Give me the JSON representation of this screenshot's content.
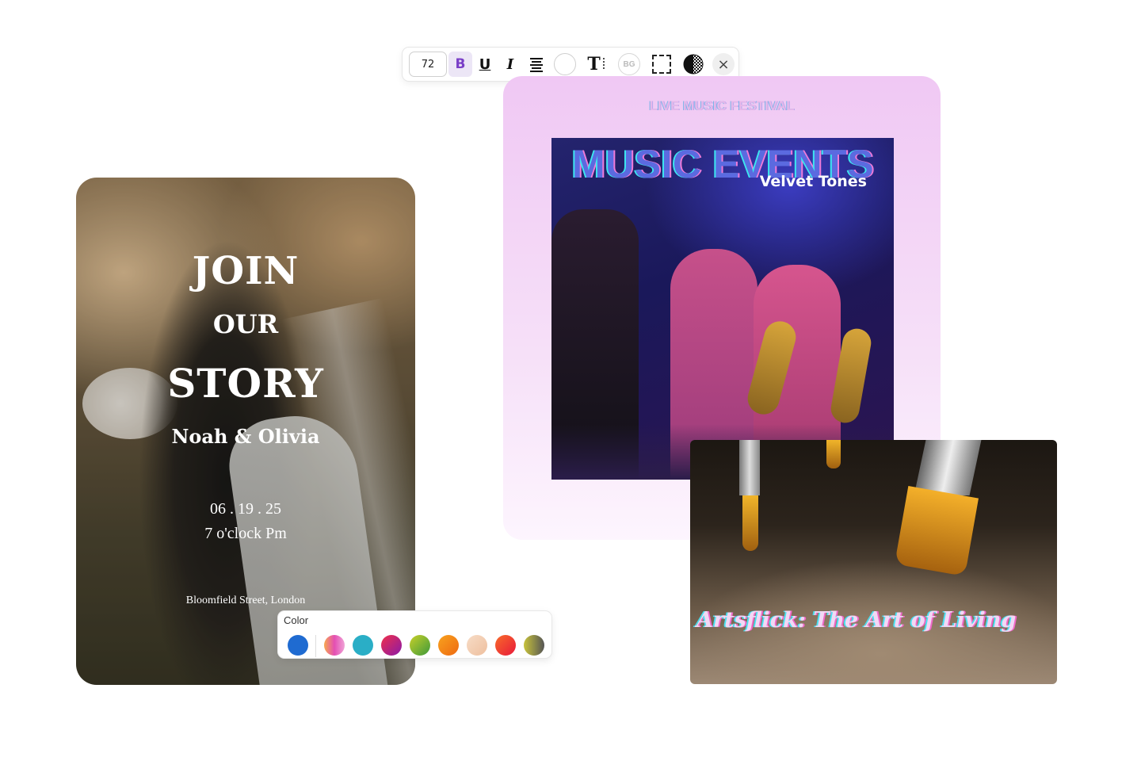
{
  "toolbar": {
    "font_size": "72",
    "bold_label": "B",
    "underline_label": "U",
    "italic_label": "I",
    "text_size_label": "T",
    "bg_label": "BG",
    "close_label": "×",
    "accent_color": "#7a3fc7"
  },
  "wedding_card": {
    "line1": "JOIN",
    "line2": "OUR",
    "line3": "STORY",
    "names": "Noah & Olivia",
    "date": "06 . 19 . 25",
    "time": "7 o'clock Pm",
    "address": "Bloomfield Street, London"
  },
  "color_picker": {
    "label": "Color",
    "swatches": [
      {
        "name": "blue",
        "color": "#1f6bd1"
      },
      {
        "name": "pink-gradient",
        "color": "#e97fb8"
      },
      {
        "name": "teal",
        "color": "#2aaec6"
      },
      {
        "name": "magenta-red",
        "color": "#d12a5a"
      },
      {
        "name": "green-yellow",
        "color": "#8cbf2a"
      },
      {
        "name": "orange",
        "color": "#f28a1e"
      },
      {
        "name": "peach",
        "color": "#f2cbb0"
      },
      {
        "name": "red-orange",
        "color": "#ef3a2e"
      },
      {
        "name": "olive-gradient",
        "color": "#8f9a3a"
      }
    ]
  },
  "music_card": {
    "kicker": "LIVE MUSIC FESTIVAL",
    "headline": "MUSIC EVENTS",
    "subtitle": "Velvet Tones"
  },
  "art_card": {
    "title": "Artsflick: The Art of Living"
  }
}
